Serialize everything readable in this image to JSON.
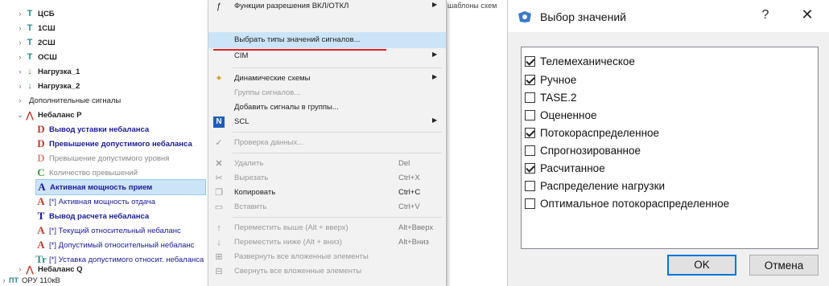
{
  "tree": {
    "items": [
      {
        "label": "ЦСБ",
        "icon": "Т",
        "indent": 1,
        "chev": "›"
      },
      {
        "label": "1СШ",
        "icon": "Т",
        "indent": 1,
        "chev": "›"
      },
      {
        "label": "2СШ",
        "icon": "Т",
        "indent": 1,
        "chev": "›"
      },
      {
        "label": "ОСШ",
        "icon": "Т",
        "indent": 1,
        "chev": "›"
      },
      {
        "label": "Нагрузка_1",
        "icon": "↓",
        "indent": 1,
        "chev": "›"
      },
      {
        "label": "Нагрузка_2",
        "icon": "↓",
        "indent": 1,
        "chev": "›"
      },
      {
        "label": "Дополнительные сигналы",
        "icon": "",
        "indent": 1,
        "chev": "›"
      },
      {
        "label": "Небаланс Р",
        "icon": "⋀",
        "indent": 1,
        "chev": "⌄"
      },
      {
        "label": "Вывод уставки небаланса",
        "icon": "D",
        "indent": 2
      },
      {
        "label": "Превышение допустимого небаланса",
        "icon": "D",
        "indent": 2
      },
      {
        "label": "Превышение допустимого уровня",
        "icon": "D",
        "indent": 2
      },
      {
        "label": "Количество превышений",
        "icon": "C",
        "indent": 2
      },
      {
        "label": "Активная мощность прием",
        "icon": "A",
        "indent": 2
      },
      {
        "label": "[*] Активная мощность отдача",
        "icon": "A",
        "indent": 2
      },
      {
        "label": "Вывод расчета небаланса",
        "icon": "T",
        "indent": 2
      },
      {
        "label": "[*] Текущий относительный небаланс",
        "icon": "A",
        "indent": 2
      },
      {
        "label": "[*] Допустимый относительный небаланс",
        "icon": "A",
        "indent": 2
      },
      {
        "label": "[*] Уставка допустимого относит. небаланса",
        "icon": "Tr",
        "indent": 2
      },
      {
        "label": "Небаланс Q",
        "icon": "⋀",
        "indent": 1,
        "chev": "›"
      },
      {
        "label": "ОРУ 110кВ",
        "icon": "ПТ",
        "indent": 0,
        "chev": "›"
      }
    ]
  },
  "context_menu": {
    "items": [
      {
        "label": "Функции разрешения ВКЛ/ОТКЛ",
        "arrow": "▶"
      },
      {
        "label": "Выбрать типы значений сигналов...",
        "highlight": true
      },
      {
        "label": "CIM",
        "arrow": "▶"
      },
      {
        "label": "Динамические схемы",
        "arrow": "▶"
      },
      {
        "label": "Группы сигналов...",
        "disabled": true
      },
      {
        "label": "Добавить сигналы в группы..."
      },
      {
        "label": "SCL",
        "arrow": "▶"
      },
      {
        "label": "Проверка данных...",
        "disabled": true
      },
      {
        "label": "Удалить",
        "key": "Del",
        "disabled": true
      },
      {
        "label": "Вырезать",
        "key": "Ctrl+X",
        "disabled": true
      },
      {
        "label": "Копировать",
        "key": "Ctrl+C"
      },
      {
        "label": "Вставить",
        "key": "Ctrl+V",
        "disabled": true
      },
      {
        "label": "Переместить выше (Alt + вверх)",
        "key": "Alt+Вверх",
        "disabled": true
      },
      {
        "label": "Переместить ниже (Alt + вниз)",
        "key": "Alt+Вниз",
        "disabled": true
      },
      {
        "label": "Развернуть все вложенные элементы",
        "disabled": true
      },
      {
        "label": "Свернуть все вложенные элементы",
        "disabled": true
      }
    ],
    "side_text": "шаблоны схем"
  },
  "dialog": {
    "title": "Выбор значений",
    "help": "?",
    "close": "✕",
    "options": [
      {
        "label": "Телемеханическое",
        "checked": true
      },
      {
        "label": "Ручное",
        "checked": true
      },
      {
        "label": "TASE.2",
        "checked": false
      },
      {
        "label": "Оцененное",
        "checked": false
      },
      {
        "label": "Потокораспределенное",
        "checked": true
      },
      {
        "label": "Спрогнозированное",
        "checked": false
      },
      {
        "label": "Расчитанное",
        "checked": true
      },
      {
        "label": "Распределение нагрузки",
        "checked": false
      },
      {
        "label": "Оптимальное потокораспределенное",
        "checked": false
      }
    ],
    "ok_label": "OK",
    "cancel_label": "Отмена"
  }
}
